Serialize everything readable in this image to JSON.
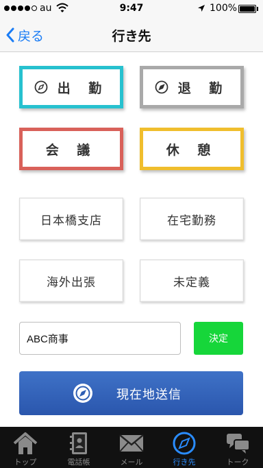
{
  "status_bar": {
    "carrier": "au",
    "time": "9:47",
    "battery": "100%"
  },
  "nav": {
    "back_label": "戻る",
    "title": "行き先"
  },
  "destinations": {
    "go_to_work": {
      "label": "出 勤",
      "color": "#27c1cf"
    },
    "leave_work": {
      "label": "退 勤",
      "color": "#a9a9a9"
    },
    "meeting": {
      "label": "会 議",
      "color": "#d9615a"
    },
    "break": {
      "label": "休 憩",
      "color": "#f0be2d"
    },
    "nihonbashi": {
      "label": "日本橋支店"
    },
    "remote": {
      "label": "在宅勤務"
    },
    "overseas": {
      "label": "海外出張"
    },
    "undecided": {
      "label": "未定義"
    }
  },
  "destination_input": {
    "value": "ABC商事",
    "decide_label": "決定",
    "decide_color": "#16d63a"
  },
  "send_location": {
    "label": "現在地送信",
    "color": "#3464b9"
  },
  "tabs": [
    {
      "label": "トップ",
      "icon": "house-icon"
    },
    {
      "label": "電話帳",
      "icon": "phonebook-icon"
    },
    {
      "label": "メール",
      "icon": "mail-icon"
    },
    {
      "label": "行き先",
      "icon": "compass-icon",
      "active": true
    },
    {
      "label": "トーク",
      "icon": "chat-icon"
    }
  ],
  "accent_color": "#1a7cf5"
}
